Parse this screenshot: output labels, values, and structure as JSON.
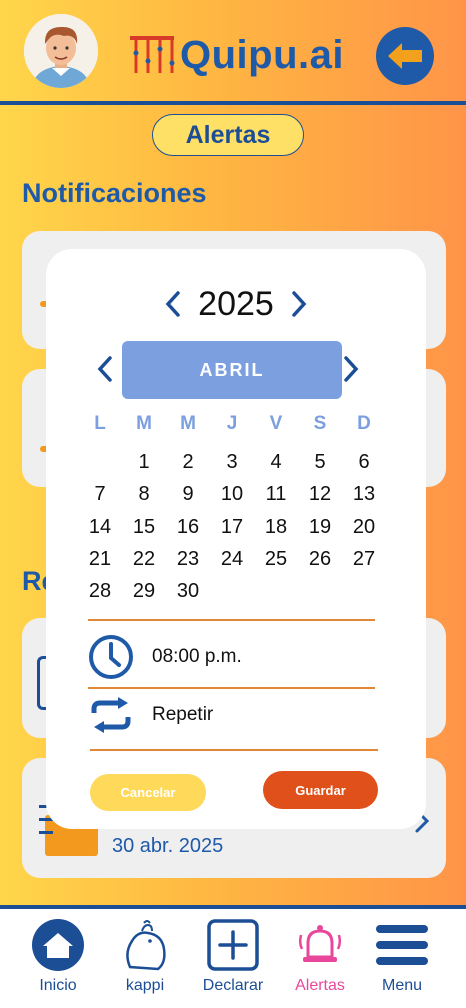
{
  "app": {
    "name": "Quipu.ai"
  },
  "page": {
    "title": "Alertas"
  },
  "sections": {
    "notifications_title": "Notificaciones",
    "reminders_title_partial": "Re"
  },
  "background_card": {
    "date": "30 abr. 2025"
  },
  "calendar": {
    "year": "2025",
    "month": "ABRIL",
    "weekdays": [
      "L",
      "M",
      "M",
      "J",
      "V",
      "S",
      "D"
    ],
    "days": [
      "",
      "1",
      "2",
      "3",
      "4",
      "5",
      "6",
      "7",
      "8",
      "9",
      "10",
      "11",
      "12",
      "13",
      "14",
      "15",
      "16",
      "17",
      "18",
      "19",
      "20",
      "21",
      "22",
      "23",
      "24",
      "25",
      "26",
      "27",
      "28",
      "29",
      "30"
    ]
  },
  "options": {
    "time": "08:00 p.m.",
    "repeat": "Repetir"
  },
  "buttons": {
    "cancel": "Cancelar",
    "save": "Guardar"
  },
  "nav": {
    "items": [
      {
        "label": "Inicio",
        "icon": "home-icon"
      },
      {
        "label": "kappi",
        "icon": "capybara-icon"
      },
      {
        "label": "Declarar",
        "icon": "plus-square-icon"
      },
      {
        "label": "Alertas",
        "icon": "bell-icon",
        "active": true
      },
      {
        "label": "Menu",
        "icon": "hamburger-icon"
      }
    ]
  },
  "colors": {
    "primary_blue": "#1e5aa8",
    "accent_orange": "#e0501a",
    "month_pill": "#7b9fdf",
    "active_nav": "#e9479b",
    "cancel_button": "#ffd95a"
  }
}
